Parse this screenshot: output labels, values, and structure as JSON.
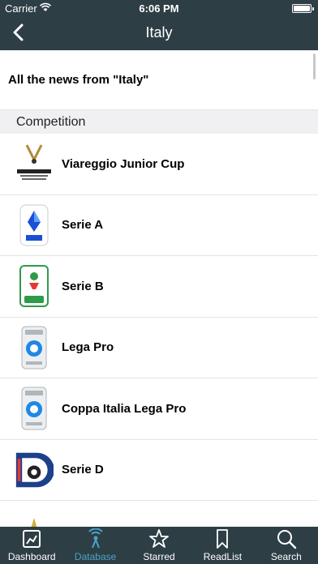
{
  "status_bar": {
    "carrier": "Carrier",
    "time": "6:06 PM"
  },
  "nav": {
    "title": "Italy",
    "back_icon": "chevron-left-icon"
  },
  "news_row": {
    "label": "All the news from \"Italy\""
  },
  "section": {
    "title": "Competition"
  },
  "competitions": [
    {
      "name": "Viareggio Junior Cup"
    },
    {
      "name": "Serie A"
    },
    {
      "name": "Serie B"
    },
    {
      "name": "Lega Pro"
    },
    {
      "name": "Coppa Italia Lega Pro"
    },
    {
      "name": "Serie D"
    }
  ],
  "tabs": [
    {
      "label": "Dashboard",
      "icon": "dashboard-icon",
      "active": false
    },
    {
      "label": "Database",
      "icon": "database-icon",
      "active": true
    },
    {
      "label": "Starred",
      "icon": "star-icon",
      "active": false
    },
    {
      "label": "ReadList",
      "icon": "bookmark-icon",
      "active": false
    },
    {
      "label": "Search",
      "icon": "search-icon",
      "active": false
    }
  ],
  "colors": {
    "bar": "#2e3e45",
    "active_tab": "#4aa3c6"
  }
}
